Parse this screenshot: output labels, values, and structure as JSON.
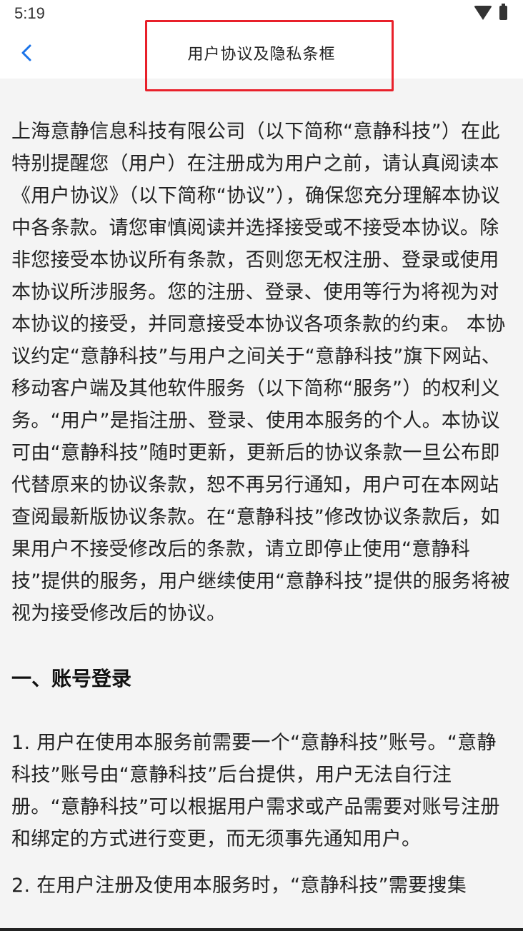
{
  "status_bar": {
    "time": "5:19",
    "icons": [
      "wifi-icon",
      "battery-icon"
    ]
  },
  "nav": {
    "back_icon": "chevron-left-icon",
    "title": "用户协议及隐私条框",
    "accent_color": "#1a73e8",
    "highlight_color": "#e8202a"
  },
  "agreement": {
    "intro": "上海意静信息科技有限公司（以下简称“意静科技”）在此特别提醒您（用户）在注册成为用户之前，请认真阅读本《用户协议》（以下简称“协议”），确保您充分理解本协议中各条款。请您审慎阅读并选择接受或不接受本协议。除非您接受本协议所有条款，否则您无权注册、登录或使用本协议所涉服务。您的注册、登录、使用等行为将视为对本协议的接受，并同意接受本协议各项条款的约束。 本协议约定“意静科技”与用户之间关于“意静科技”旗下网站、移动客户端及其他软件服务（以下简称“服务”）的权利义务。“用户”是指注册、登录、使用本服务的个人。本协议可由“意静科技”随时更新，更新后的协议条款一旦公布即代替原来的协议条款，恕不再另行通知，用户可在本网站查阅最新版协议条款。在“意静科技”修改协议条款后，如果用户不接受修改后的条款，请立即停止使用“意静科技”提供的服务，用户继续使用“意静科技”提供的服务将被视为接受修改后的协议。",
    "section1_title": "一、账号登录",
    "section1_item1": "1. 用户在使用本服务前需要一个“意静科技”账号。“意静科技”账号由“意静科技”后台提供，用户无法自行注册。“意静科技”可以根据用户需求或产品需要对账号注册和绑定的方式进行变更，而无须事先通知用户。",
    "section1_item2": "2. 在用户注册及使用本服务时，“意静科技”需要搜集"
  }
}
